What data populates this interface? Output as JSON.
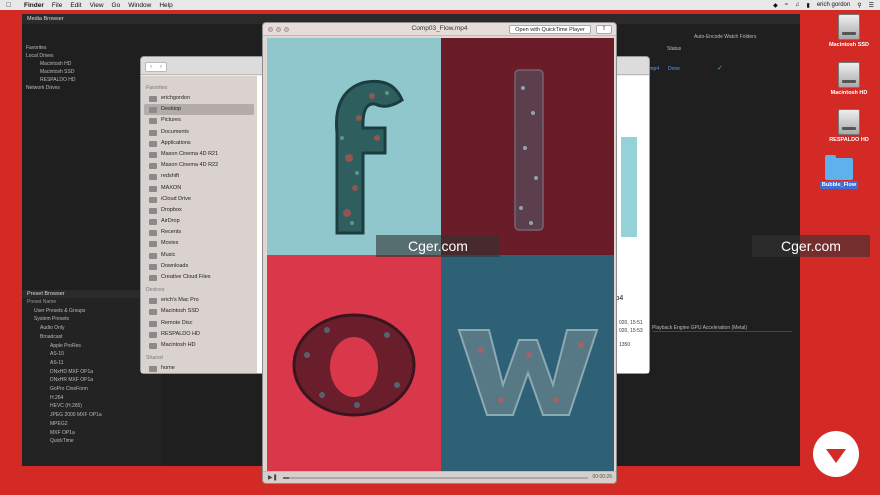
{
  "menubar": {
    "app": "Finder",
    "items": [
      "File",
      "Edit",
      "View",
      "Go",
      "Window",
      "Help"
    ],
    "user": "erich gordon"
  },
  "desktop": {
    "icons": [
      "Macintosh SSD",
      "Macintosh HD",
      "RESPALDO HD",
      "Bubble_Flow"
    ]
  },
  "ame": {
    "panel_title": "Media Browser",
    "tree": [
      "Favorites",
      "Local Drives",
      "Macintosh HD",
      "Macintosh SSD",
      "RESPALDO HD",
      "Network Drives"
    ],
    "watch_label": "Auto-Encode Watch Folders",
    "status_header": "Status",
    "queue_file": ".mp4",
    "queue_status": "Done",
    "renderer": "Playback Engine GPU Acceleration (Metal)",
    "preset_browser": {
      "title": "Preset Browser",
      "name_header": "Preset Name",
      "rows": [
        "User Presets & Groups",
        "System Presets",
        "Audio Only",
        "Broadcast",
        "Apple ProRes",
        "AS-10",
        "AS-11",
        "DNxHD MXF OP1a",
        "DNxHR MXF OP1a",
        "GoPro CineForm",
        "H.264",
        "HEVC (H.265)",
        "JPEG 2000 MXF OP1a",
        "MPEG2",
        "MXF OP1a",
        "QuickTime"
      ]
    }
  },
  "finder": {
    "favorites_label": "Favorites",
    "favorites": [
      "erichgordon",
      "Desktop",
      "Pictures",
      "Documents",
      "Applications",
      "Maxon Cinema 4D R21",
      "Maxon Cinema 4D R22",
      "redshift",
      "MAXON",
      "iCloud Drive",
      "Dropbox",
      "AirDrop",
      "Recents",
      "Movies",
      "Music",
      "Downloads",
      "Creative Cloud Files"
    ],
    "devices_label": "Devices",
    "devices": [
      "erich's Mac Pro",
      "Macintosh SSD",
      "Remote Disc",
      "RESPALDO HD",
      "Macintosh HD"
    ],
    "shared_label": "Shared",
    "shared": [
      "home"
    ],
    "preview": {
      "name": "w.mp4",
      "meta": [
        "020, 15:51",
        "020, 15:53",
        "1350"
      ]
    }
  },
  "quicktime": {
    "title": "Comp03_Flow.mp4",
    "open_button": "Open with QuickTime Player",
    "time": "00:00:26",
    "progress": 0.02
  },
  "watermark": "Cger.com",
  "colors": {
    "desktop": "#d42a26",
    "q1": "#8fc7cc",
    "q2": "#6a1d28",
    "q3": "#d9374a",
    "q4": "#2e6176"
  }
}
